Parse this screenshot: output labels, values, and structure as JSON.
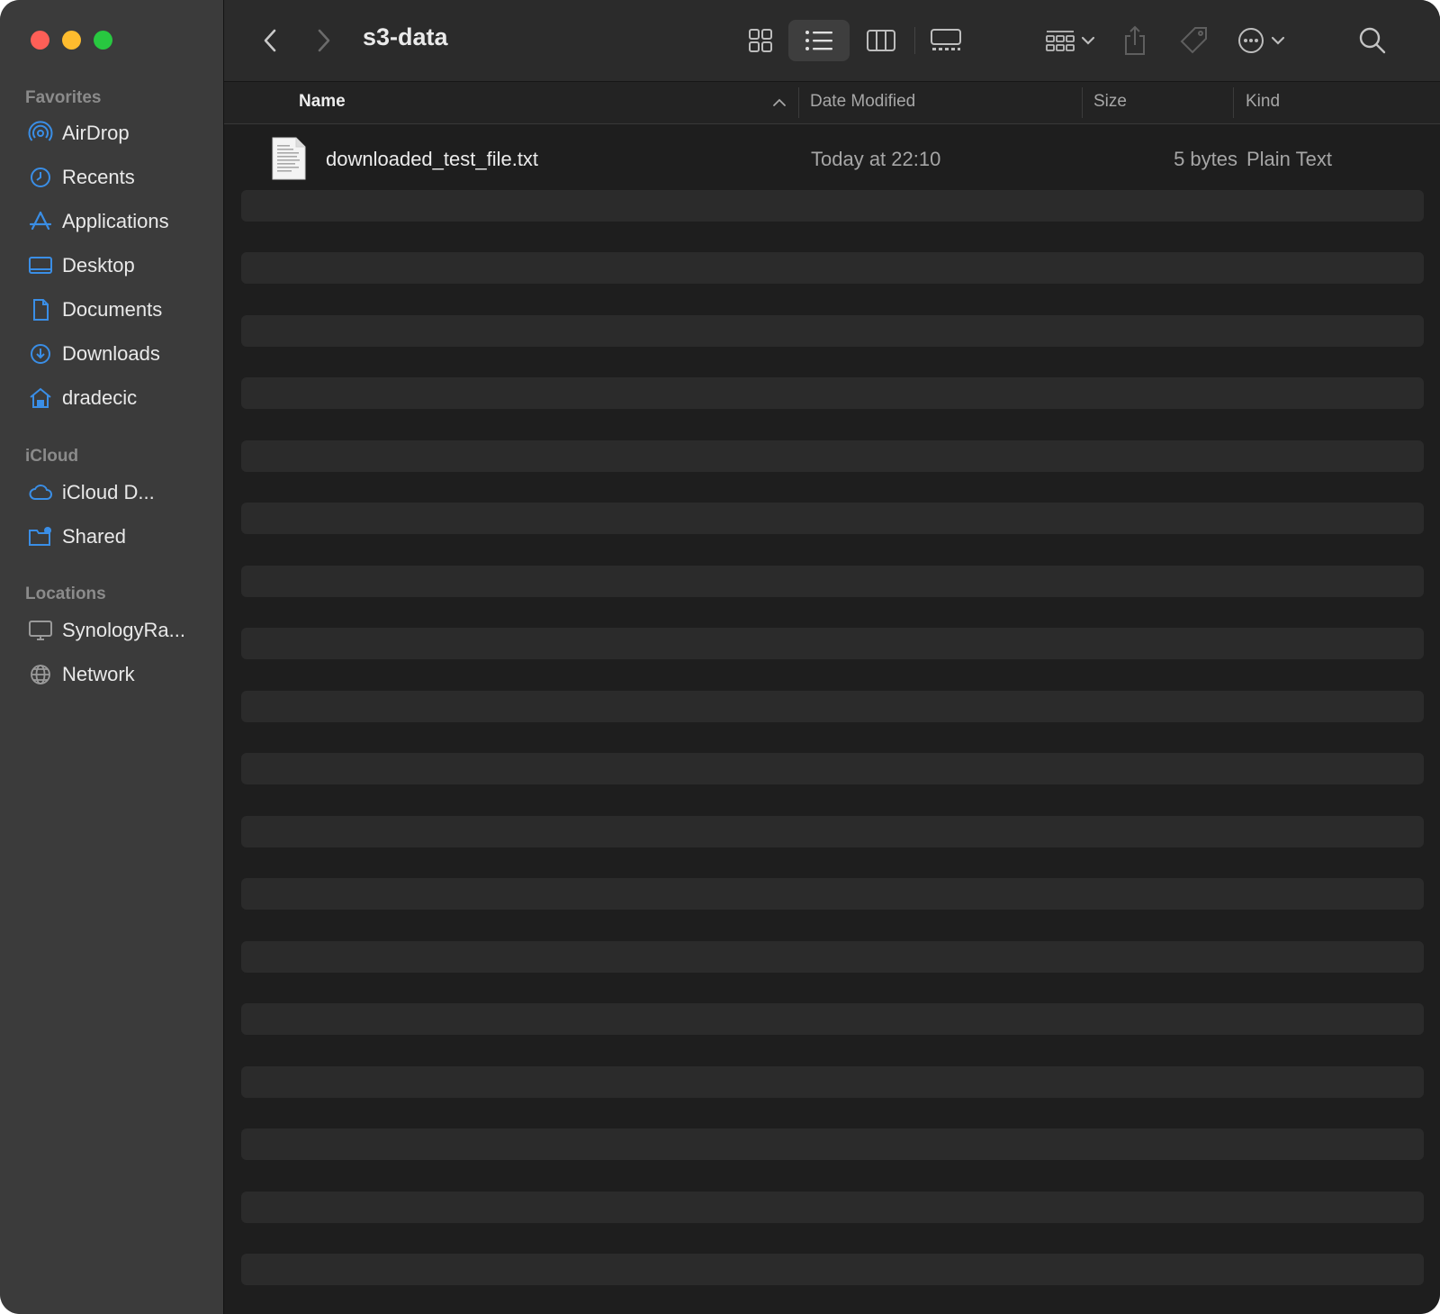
{
  "window": {
    "traffic_lights": {
      "close": "#ff5f57",
      "minimize": "#febc2e",
      "zoom": "#28c840"
    }
  },
  "sidebar": {
    "sections": [
      {
        "title": "Favorites",
        "items": [
          {
            "label": "AirDrop",
            "icon": "airdrop-icon"
          },
          {
            "label": "Recents",
            "icon": "clock-icon"
          },
          {
            "label": "Applications",
            "icon": "applications-icon"
          },
          {
            "label": "Desktop",
            "icon": "desktop-icon"
          },
          {
            "label": "Documents",
            "icon": "document-icon"
          },
          {
            "label": "Downloads",
            "icon": "download-icon"
          },
          {
            "label": "dradecic",
            "icon": "home-icon"
          }
        ]
      },
      {
        "title": "iCloud",
        "items": [
          {
            "label": "iCloud D...",
            "icon": "cloud-icon"
          },
          {
            "label": "Shared",
            "icon": "shared-folder-icon"
          }
        ]
      },
      {
        "title": "Locations",
        "items": [
          {
            "label": "SynologyRa...",
            "icon": "monitor-icon"
          },
          {
            "label": "Network",
            "icon": "globe-icon"
          }
        ]
      }
    ]
  },
  "toolbar": {
    "title": "s3-data",
    "view_modes": [
      "icon-view",
      "list-view",
      "column-view",
      "gallery-view"
    ],
    "selected_view": "list-view"
  },
  "columns": {
    "name": "Name",
    "date_modified": "Date Modified",
    "size": "Size",
    "kind": "Kind"
  },
  "files": [
    {
      "name": "downloaded_test_file.txt",
      "date_modified": "Today at 22:10",
      "size": "5 bytes",
      "kind": "Plain Text"
    }
  ],
  "colors": {
    "accent": "#3a8ee6",
    "sidebar_bg": "#3b3b3b",
    "content_bg": "#1e1e1e",
    "stripe": "#2b2b2b"
  }
}
